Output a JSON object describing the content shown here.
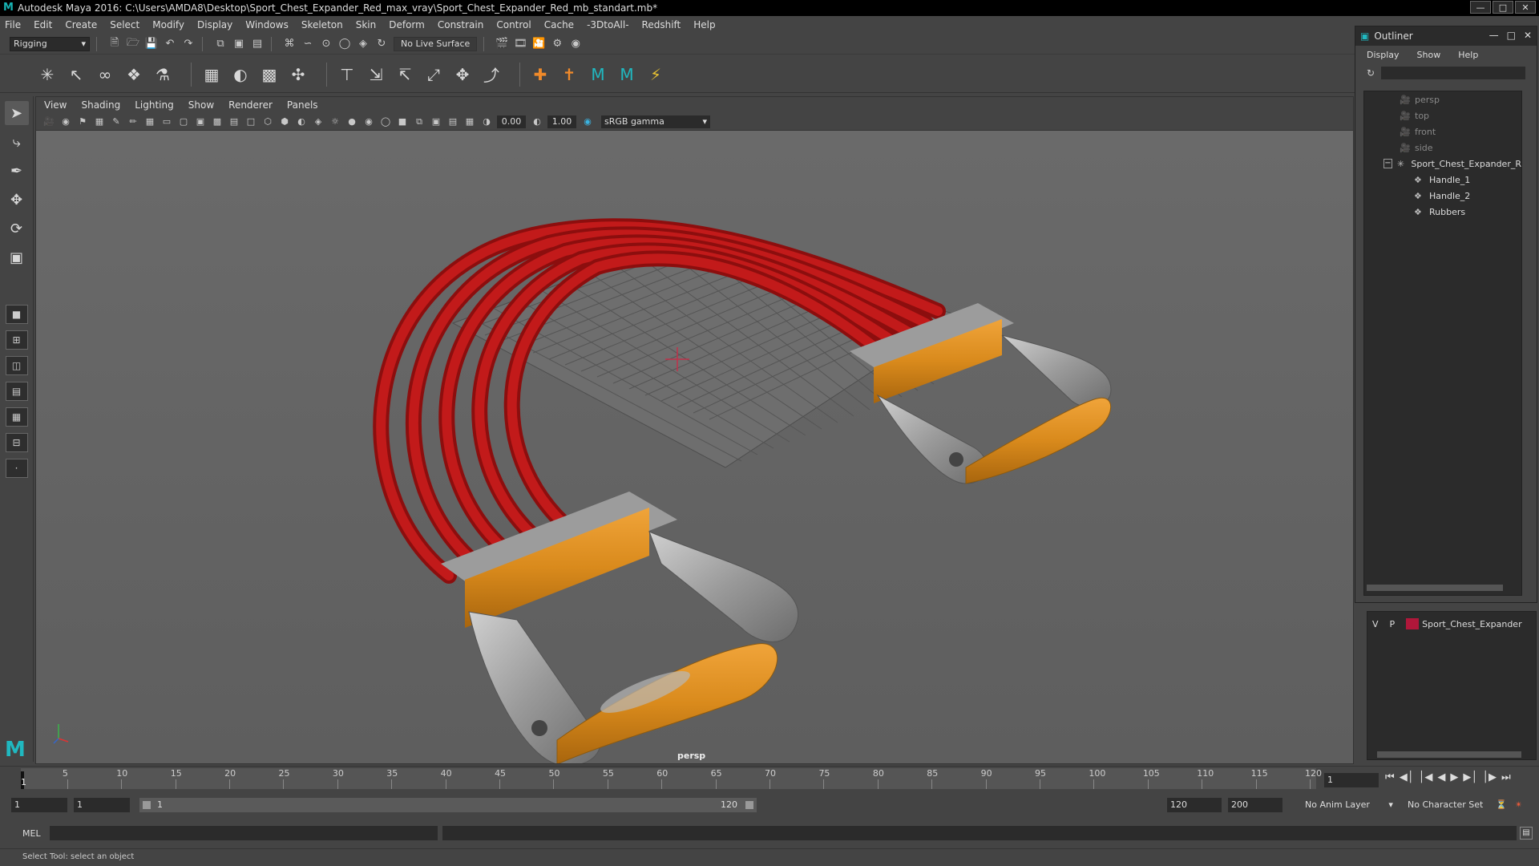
{
  "window": {
    "title": "Autodesk Maya 2016: C:\\Users\\AMDA8\\Desktop\\Sport_Chest_Expander_Red_max_vray\\Sport_Chest_Expander_Red_mb_standart.mb*"
  },
  "menubar": {
    "items": [
      "File",
      "Edit",
      "Create",
      "Select",
      "Modify",
      "Display",
      "Windows",
      "Skeleton",
      "Skin",
      "Deform",
      "Constrain",
      "Control",
      "Cache",
      "-3DtoAll-",
      "Redshift",
      "Help"
    ]
  },
  "statusline": {
    "mode": "Rigging",
    "live_surface": "No Live Surface"
  },
  "viewport": {
    "menu": [
      "View",
      "Shading",
      "Lighting",
      "Show",
      "Renderer",
      "Panels"
    ],
    "exposure": "0.00",
    "gamma": "1.00",
    "colorspace": "sRGB gamma",
    "camera_label": "persp"
  },
  "outliner": {
    "title": "Outliner",
    "menu": [
      "Display",
      "Show",
      "Help"
    ],
    "items": [
      {
        "label": "persp",
        "type": "camera"
      },
      {
        "label": "top",
        "type": "camera"
      },
      {
        "label": "front",
        "type": "camera"
      },
      {
        "label": "side",
        "type": "camera"
      },
      {
        "label": "Sport_Chest_Expander_R",
        "type": "group"
      },
      {
        "label": "Handle_1",
        "type": "mesh"
      },
      {
        "label": "Handle_2",
        "type": "mesh"
      },
      {
        "label": "Rubbers",
        "type": "mesh"
      }
    ]
  },
  "layer": {
    "visible": "V",
    "playback": "P",
    "name": "Sport_Chest_Expander",
    "color": "#b0173a"
  },
  "timeslider": {
    "ticks": [
      "5",
      "10",
      "15",
      "20",
      "25",
      "30",
      "35",
      "40",
      "45",
      "50",
      "55",
      "60",
      "65",
      "70",
      "75",
      "80",
      "85",
      "90",
      "95",
      "100",
      "105",
      "110",
      "115",
      "120"
    ],
    "first_frame": "1",
    "current_frame": "1"
  },
  "rangebar": {
    "start": "1",
    "playback_start": "1",
    "range_start_label": "1",
    "range_end_label": "120",
    "playback_end": "120",
    "end": "200",
    "anim_layer": "No Anim Layer",
    "character_set": "No Character Set"
  },
  "cmdline": {
    "label": "MEL"
  },
  "helpline": {
    "text": "Select Tool: select an object"
  }
}
